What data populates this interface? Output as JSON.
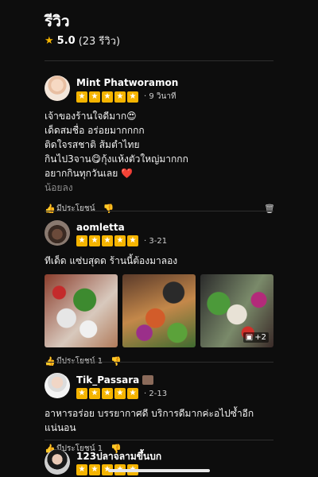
{
  "header": {
    "title": "รีวิว",
    "rating": "5.0",
    "count": "(23 รีวิว)"
  },
  "reviews": [
    {
      "name": "Mint Phatworamon",
      "time": "· 9 วินาที",
      "lines": [
        "เจ้าของร้านใจดีมาก😍",
        "เด็ดสมชื่อ อร่อยมากกกก",
        "ติดใจรสชาติ ส้มตำไทย",
        "กินไป3จาน😋กุ้งแห้งตัวใหญ่มากกก",
        "อยากกินทุกวันเลย ❤️"
      ],
      "more": "น้อยลง",
      "helpful": "มีประโยชน์"
    },
    {
      "name": "aomletta",
      "time": "· 3-21",
      "lines": [
        "ทีเด็ด แซ่บสุดด ร้านนี้ต้องมาลอง"
      ],
      "photo_more": "+2",
      "helpful": "มีประโยชน์ 1"
    },
    {
      "name": "Tik_Passara",
      "time": "· 2-13",
      "lines": [
        "อาหารอร่อย บรรยากาศดี บริการดีมากค่ะอไปซ้ำอีกแน่นอน"
      ],
      "helpful": "มีประโยชน์ 1"
    },
    {
      "name": "123ปลาจลามขึ้นบก"
    }
  ],
  "icons": {
    "star": "star-icon",
    "thumb_up": "thumbs-up-icon",
    "thumb_down": "thumbs-down-icon",
    "trash": "trash-icon"
  },
  "colors": {
    "star": "#f5b400",
    "background": "#0d0d0d"
  }
}
